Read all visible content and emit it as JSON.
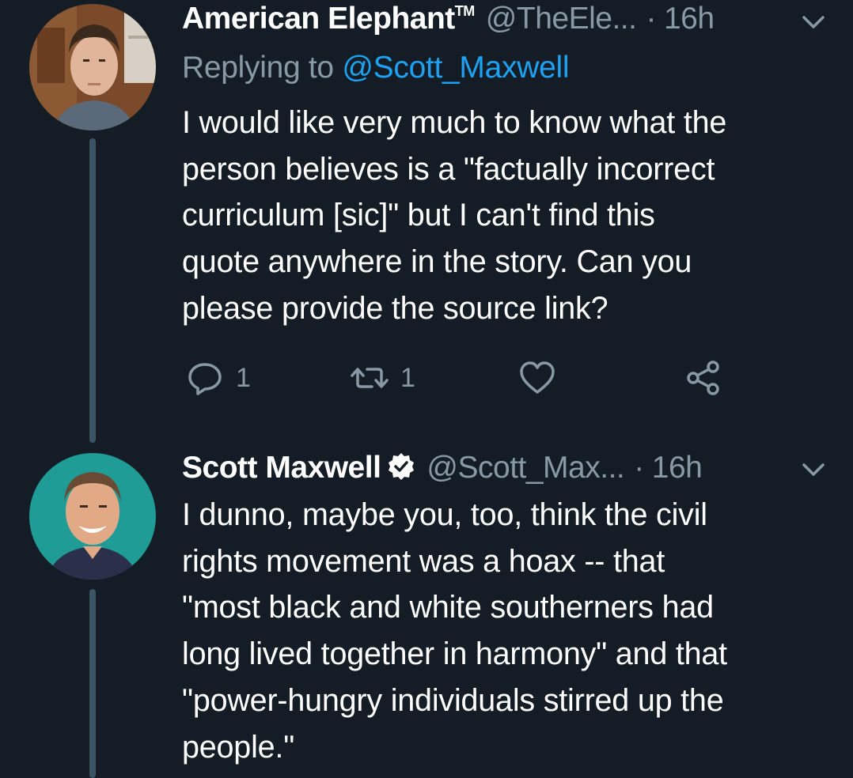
{
  "tweets": [
    {
      "author_name": "American Elephant",
      "author_mark": "TM",
      "handle": "@TheEle...",
      "separator": "·",
      "time": "16h",
      "replying_prefix": "Replying to",
      "replying_handle": "@Scott_Maxwell",
      "body_lines": [
        "I would like very much to know what the",
        "person believes is a \"factually incorrect",
        "curriculum [sic]\" but I can't find this",
        "quote anywhere in the story. Can you",
        "please provide the source link?"
      ],
      "reply_count": "1",
      "retweet_count": "1",
      "avatar_icon": "user-avatar-photo"
    },
    {
      "author_name": "Scott Maxwell",
      "verified": true,
      "handle": "@Scott_Max...",
      "separator": "·",
      "time": "16h",
      "body_lines": [
        "I dunno, maybe you, too, think the civil",
        "rights movement was a hoax -- that",
        "\"most black and white southerners had",
        "long lived together in harmony\" and that",
        "\"power-hungry individuals stirred up the",
        "people.\""
      ],
      "avatar_icon": "user-avatar-photo"
    }
  ],
  "colors": {
    "background": "#141d26",
    "text_primary": "#ffffff",
    "text_secondary": "#8899a6",
    "link": "#1da1f2",
    "thread_line": "#3d5466",
    "verified_badge": "#ffffff"
  },
  "icons": {
    "reply": "reply-icon",
    "retweet": "retweet-icon",
    "like": "heart-icon",
    "share": "share-icon",
    "menu": "chevron-down-icon",
    "verified": "verified-badge-icon"
  }
}
